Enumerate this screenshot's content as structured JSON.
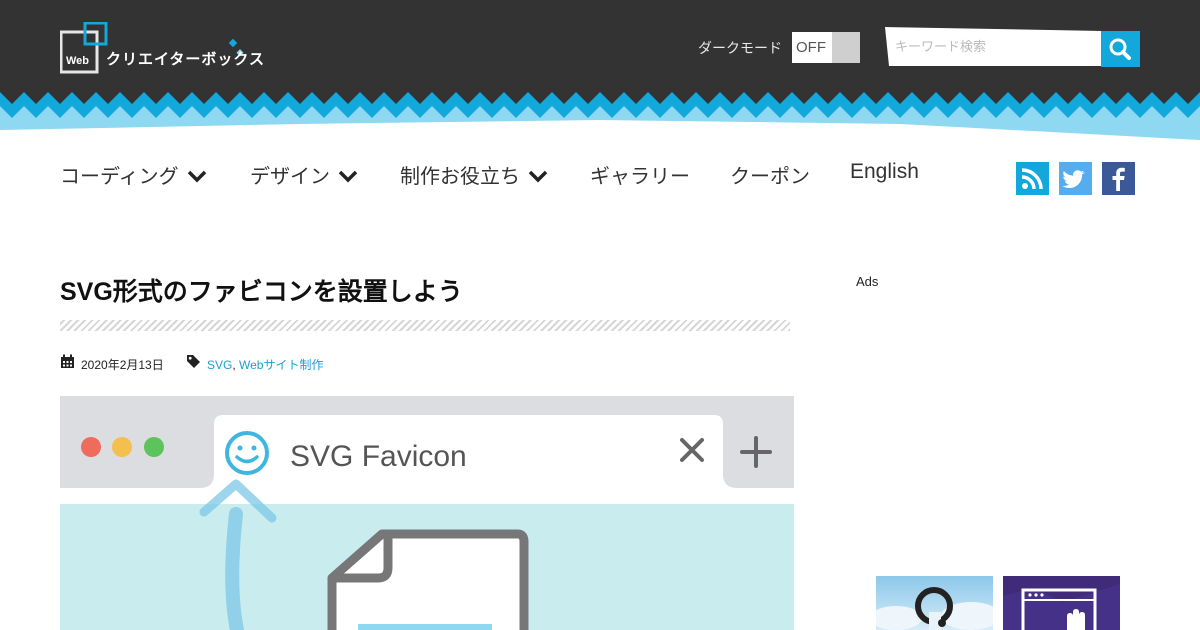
{
  "header": {
    "logo": {
      "badge": "Web",
      "name": "クリエイターボックス"
    },
    "dark_mode": {
      "label": "ダークモード",
      "state": "OFF"
    },
    "search": {
      "placeholder": "キーワード検索",
      "value": ""
    }
  },
  "nav": {
    "items": [
      {
        "label": "コーディング",
        "has_dropdown": true
      },
      {
        "label": "デザイン",
        "has_dropdown": true
      },
      {
        "label": "制作お役立ち",
        "has_dropdown": true
      },
      {
        "label": "ギャラリー",
        "has_dropdown": false
      },
      {
        "label": "クーポン",
        "has_dropdown": false
      },
      {
        "label": "English",
        "has_dropdown": false
      }
    ],
    "social": [
      "rss-icon",
      "twitter-icon",
      "facebook-icon"
    ]
  },
  "article": {
    "title": "SVG形式のファビコンを設置しよう",
    "date": "2020年2月13日",
    "tags": [
      "SVG",
      "Webサイト制作"
    ],
    "eyecatch": {
      "tab_title": "SVG Favicon"
    }
  },
  "sidebar": {
    "ads_label": "Ads"
  },
  "colors": {
    "header_bg": "#333333",
    "accent": "#12a8dc",
    "zigzag_light": "#8fd8f2",
    "rss": "#12a8dc",
    "twitter": "#55acee",
    "facebook": "#3b5998"
  }
}
